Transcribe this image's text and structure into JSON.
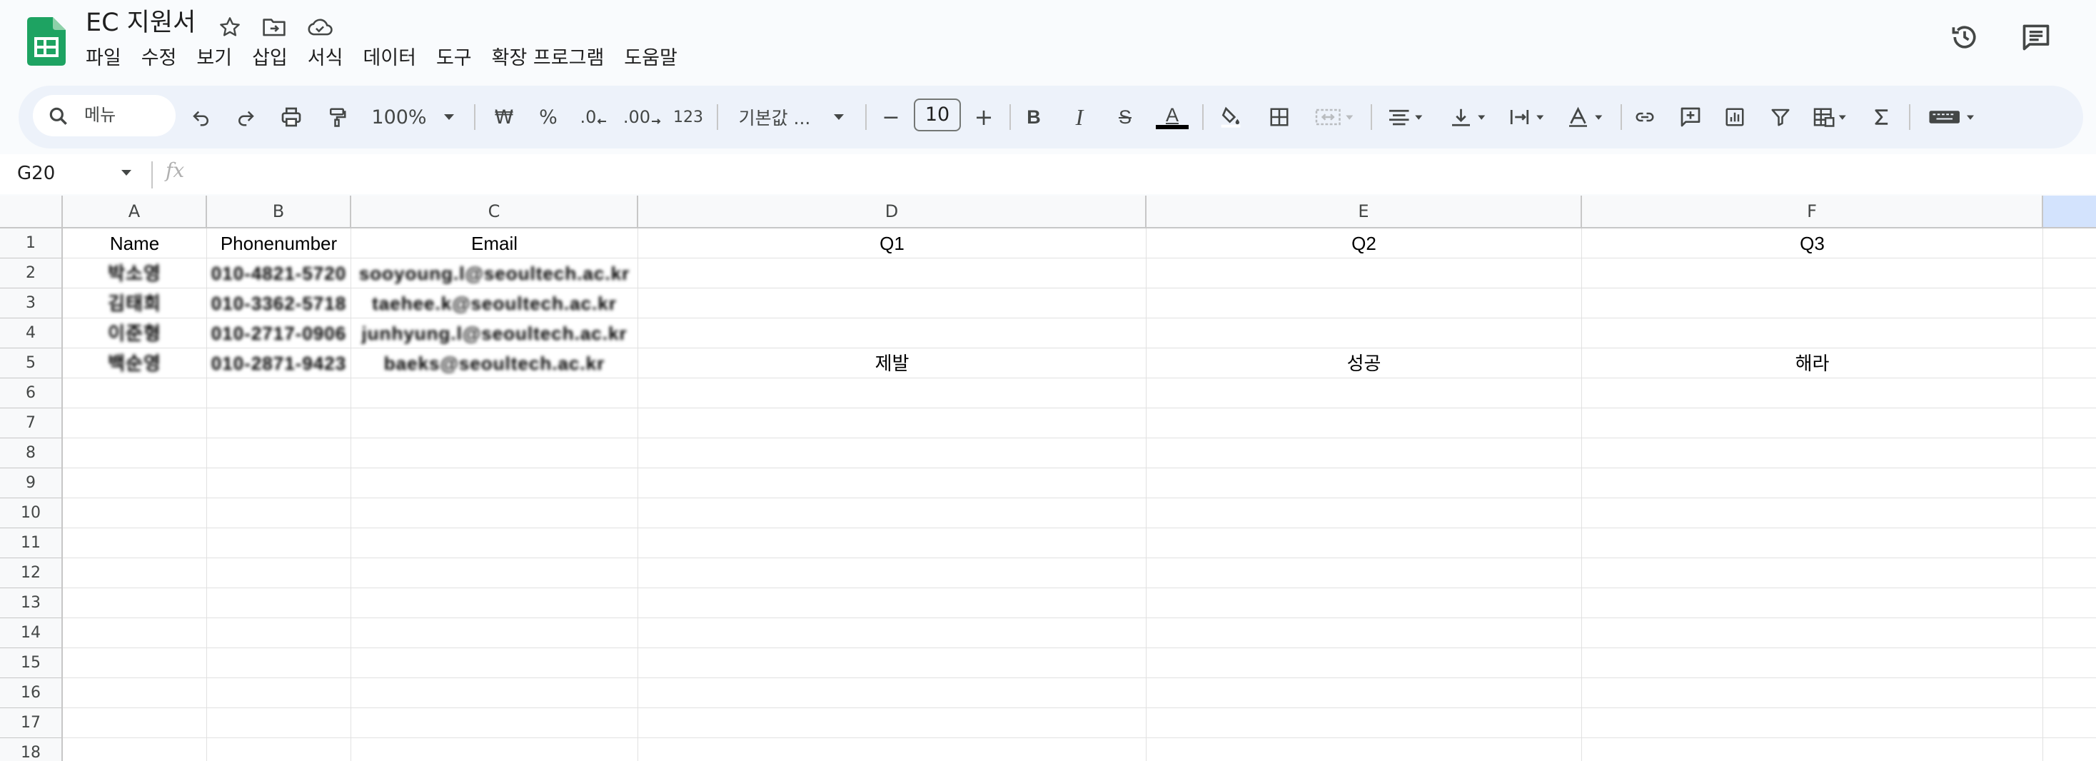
{
  "app": {
    "title": "EC 지원서",
    "menu": [
      "파일",
      "수정",
      "보기",
      "삽입",
      "서식",
      "데이터",
      "도구",
      "확장 프로그램",
      "도움말"
    ]
  },
  "toolbar": {
    "search_label": "메뉴",
    "zoom": "100%",
    "currency": "₩",
    "percent": "%",
    "dec_decrease": ".0",
    "dec_increase": ".00",
    "number_format": "123",
    "font": "기본값 ...",
    "minus": "−",
    "font_size": "10",
    "plus": "+",
    "bold": "B",
    "italic": "I",
    "strike": "S",
    "text_color": "A"
  },
  "formula_bar": {
    "name_box": "G20",
    "fx": "fx"
  },
  "sheet": {
    "columns": [
      "A",
      "B",
      "C",
      "D",
      "E",
      "F"
    ],
    "rows": [
      "1",
      "2",
      "3",
      "4",
      "5",
      "6",
      "7",
      "8",
      "9",
      "10",
      "11",
      "12",
      "13",
      "14",
      "15",
      "16",
      "17",
      "18"
    ],
    "header_row": [
      "Name",
      "Phonenumber",
      "Email",
      "Q1",
      "Q2",
      "Q3"
    ],
    "data_rows": [
      [
        "박소영",
        "010-4821-5720",
        "sooyoung.l@seoultech.ac.kr",
        "",
        "",
        ""
      ],
      [
        "김태희",
        "010-3362-5718",
        "taehee.k@seoultech.ac.kr",
        "",
        "",
        ""
      ],
      [
        "이준형",
        "010-2717-0906",
        "junhyung.l@seoultech.ac.kr",
        "",
        "",
        ""
      ],
      [
        "백순영",
        "010-2871-9423",
        "baeks@seoultech.ac.kr",
        "제발",
        "성공",
        "해라"
      ]
    ]
  }
}
